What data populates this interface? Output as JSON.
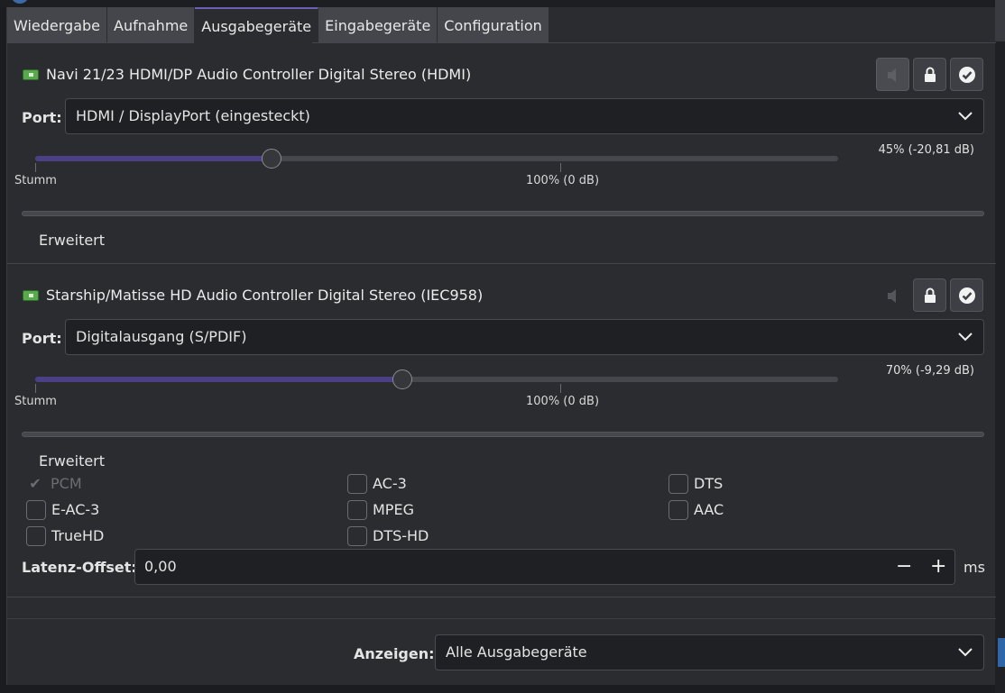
{
  "tabs": [
    {
      "label": "Wiedergabe"
    },
    {
      "label": "Aufnahme"
    },
    {
      "label": "Ausgabegeräte"
    },
    {
      "label": "Eingabegeräte"
    },
    {
      "label": "Configuration"
    }
  ],
  "active_tab": "Ausgabegeräte",
  "devices": [
    {
      "name": "Navi 21/23 HDMI/DP Audio Controller Digital Stereo (HDMI)",
      "port_label": "Port:",
      "port_value": "HDMI / DisplayPort (eingesteckt)",
      "volume_text": "45% (-20,81 dB)",
      "volume_fraction": 0.45,
      "mute_label": "Stumm",
      "ref_label": "100% (0 dB)",
      "advanced_label": "Erweitert"
    },
    {
      "name": "Starship/Matisse HD Audio Controller Digital Stereo (IEC958)",
      "port_label": "Port:",
      "port_value": "Digitalausgang (S/PDIF)",
      "volume_text": "70% (-9,29 dB)",
      "volume_fraction": 0.7,
      "mute_label": "Stumm",
      "ref_label": "100% (0 dB)",
      "advanced_label": "Erweitert",
      "formats": [
        {
          "label": "PCM",
          "checked": true,
          "disabled": true
        },
        {
          "label": "AC-3",
          "checked": false
        },
        {
          "label": "DTS",
          "checked": false
        },
        {
          "label": "E-AC-3",
          "checked": false
        },
        {
          "label": "MPEG",
          "checked": false
        },
        {
          "label": "AAC",
          "checked": false
        },
        {
          "label": "TrueHD",
          "checked": false
        },
        {
          "label": "DTS-HD",
          "checked": false
        }
      ],
      "latency_label": "Latenz-Offset:",
      "latency_value": "0,00",
      "latency_unit": "ms",
      "minus": "−",
      "plus": "+"
    }
  ],
  "footer": {
    "show_label": "Anzeigen:",
    "show_value": "Alle Ausgabegeräte"
  },
  "icons": {
    "device": "sound-card-icon",
    "mute": "speaker-icon",
    "lock": "lock-icon",
    "default": "check-circle-icon",
    "dropdown": "chevron-down-icon"
  },
  "colors": {
    "accent": "#6b5fb6",
    "slider_fill": "#4b3f86",
    "device_icon": "#5aa84e"
  }
}
